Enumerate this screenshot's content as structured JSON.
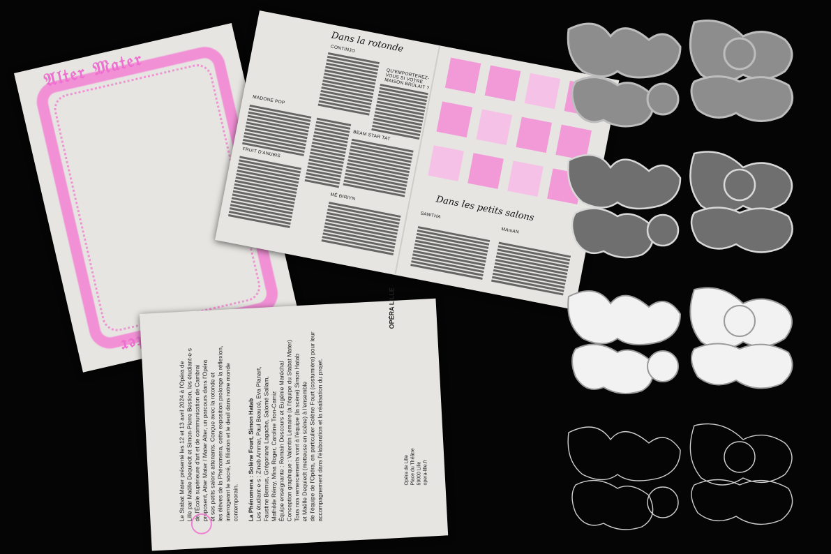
{
  "booklet": {
    "section1_title": "Dans la rotonde",
    "section2_title": "Dans les petits salons",
    "artists": [
      "CONTINJO",
      "MADONE POP",
      "FRUIT D'ANUBIS",
      "QU'EMPORTEREZ-VOUS SI VOTRE MAISON BRÛLAIT ?",
      "BEAM STAR TAT",
      "MÉ ĐIRIYN",
      "SAWTHA",
      "MAmAN"
    ]
  },
  "back": {
    "lines": [
      "Le Stabat Mater présenté les 12 et 13 avril 2024 à l'Opéra de",
      "Lille par Maëlle Dequiedt et Simon-Pierre Bestion, les étudiant·e·s",
      "de l'École supérieure d'art et de communication de Cambrai",
      "proposent, Atter Mater / Mater Alter, un parcours dans l'Opéra",
      "et ses petits salons attenants. Conçue avec la rotonde et",
      "les élèves de la Phénomena, cette exposition prolonge la réflexion,",
      "interrogeant le sacré, la filiation et le deuil dans notre monde",
      "contemporain.",
      "",
      "La Phénomena : Solène Fourt, Simon Hatab",
      "Les étudiant·e·s : Zineb Ammar, Paul Beaucé, Eva Planart,",
      "Faustine Bernus, Grégoriane Lagache, Salomé Sallam,",
      "Mathilde Rémy, Mina Roger, Caroline Tron-Camiz",
      "Équipe enseignante : Romain Descours et Eugénie Maréchal",
      "Conception graphique : Valentin Lemaire (à l'équipe du Stabat Mater)",
      "Tous nos remerciements vont à l'équipe (la scène) Simon Hatab",
      "et Maëlle Dequiedt (metteuse en scène) à l'ensemble",
      "de l'équipe de l'Opéra, en particulier Solène Fourt (costumière) pour leur",
      "accompagnement dans l'élaboration et la réalisation du projet."
    ],
    "address": [
      "Opéra de Lille",
      "Place du Théâtre",
      "59000 Lille",
      "opera-lille.fr"
    ],
    "logo": "OPÉRA LILLE"
  },
  "colors": {
    "background": "#050505",
    "paper": "#e6e5e1",
    "pink": "#f07fd0",
    "grey_art": "#8d8d8d",
    "white_art": "#ffffff"
  }
}
